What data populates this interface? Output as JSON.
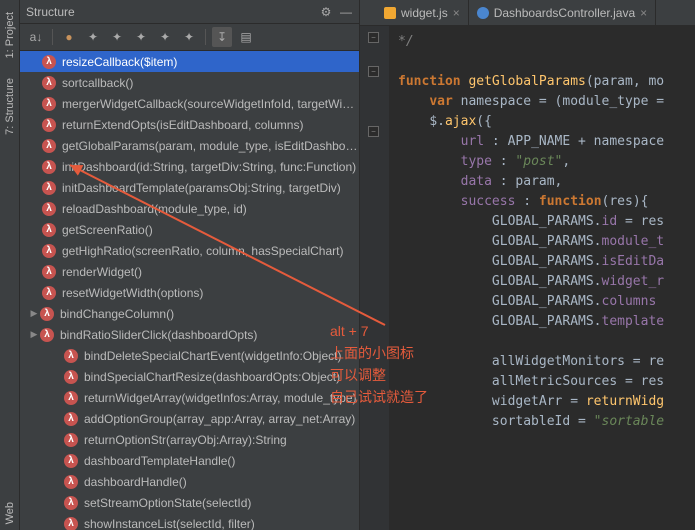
{
  "left_strip": {
    "project": "1: Project",
    "structure": "7: Structure",
    "web": "Web"
  },
  "structure_panel": {
    "title": "Structure",
    "items": [
      {
        "label": "resizeCallback($item)",
        "selected": true
      },
      {
        "label": "sortcallback()"
      },
      {
        "label": "mergerWidgetCallback(sourceWidgetInfoId, targetWidgetInfoId)"
      },
      {
        "label": "returnExtendOpts(isEditDashboard, columns)"
      },
      {
        "label": "getGlobalParams(param, module_type, isEditDashboard, func:Function)"
      },
      {
        "label": "initDashboard(id:String, targetDiv:String, func:Function)"
      },
      {
        "label": "initDashboardTemplate(paramsObj:String, targetDiv)"
      },
      {
        "label": "reloadDashboard(module_type, id)"
      },
      {
        "label": "getScreenRatio()"
      },
      {
        "label": "getHighRatio(screenRatio, column, hasSpecialChart)"
      },
      {
        "label": "renderWidget()"
      },
      {
        "label": "resetWidgetWidth(options)"
      },
      {
        "label": "bindChangeColumn()",
        "expander": "▶"
      },
      {
        "label": "bindRatioSliderClick(dashboardOpts)",
        "expander": "▶"
      },
      {
        "label": "bindDeleteSpecialChartEvent(widgetInfo:Object)",
        "indent": 2
      },
      {
        "label": "bindSpecialChartResize(dashboardOpts:Object)",
        "indent": 2
      },
      {
        "label": "returnWidgetArray(widgetInfos:Array, module_type)",
        "indent": 2
      },
      {
        "label": "addOptionGroup(array_app:Array, array_net:Array)",
        "indent": 2
      },
      {
        "label": "returnOptionStr(arrayObj:Array):String",
        "indent": 2
      },
      {
        "label": "dashboardTemplateHandle()",
        "indent": 2
      },
      {
        "label": "dashboardHandle()",
        "indent": 2
      },
      {
        "label": "setStreamOptionState(selectId)",
        "indent": 2
      },
      {
        "label": "showInstanceList(selectId, filter)",
        "indent": 2
      }
    ]
  },
  "tabs": [
    {
      "name": "widget.js",
      "kind": "js"
    },
    {
      "name": "DashboardsController.java",
      "kind": "java"
    }
  ],
  "code": {
    "l0": "*/",
    "kw_function": "function",
    "fn_get": "getGlobalParams",
    "params_get": "(param, mo",
    "kw_var": "var",
    "ns": " namespace = (module_type =",
    "ajax": "$.",
    "fn_ajax": "ajax",
    "ajax_open": "({",
    "prop_url": "url",
    "url_val": " : APP_NAME + namespace",
    "prop_type": "type",
    "type_val": "\"post\"",
    "prop_data": "data",
    "data_val": " : param,",
    "prop_success": "success",
    "success_mid": " : ",
    "success_arg": "(res){",
    "gp": "GLOBAL_PARAMS.",
    "gp_id": "id",
    "gp_id_r": " = res",
    "gp_mod": "module_t",
    "gp_edit": "isEditDa",
    "gp_wr": "widget_r",
    "gp_cols": "columns",
    "gp_tmpl": "template",
    "awm": "allWidgetMonitors = re",
    "ams": "allMetricSources = res",
    "wa": "widgetArr = ",
    "fn_rw": "returnWidg",
    "si": "sortableId = ",
    "si_str": "\"sortable"
  },
  "annotation": {
    "l1": "alt + 7",
    "l2": "上面的小图标",
    "l3": "可以调整",
    "l4": "自己试试就造了"
  }
}
